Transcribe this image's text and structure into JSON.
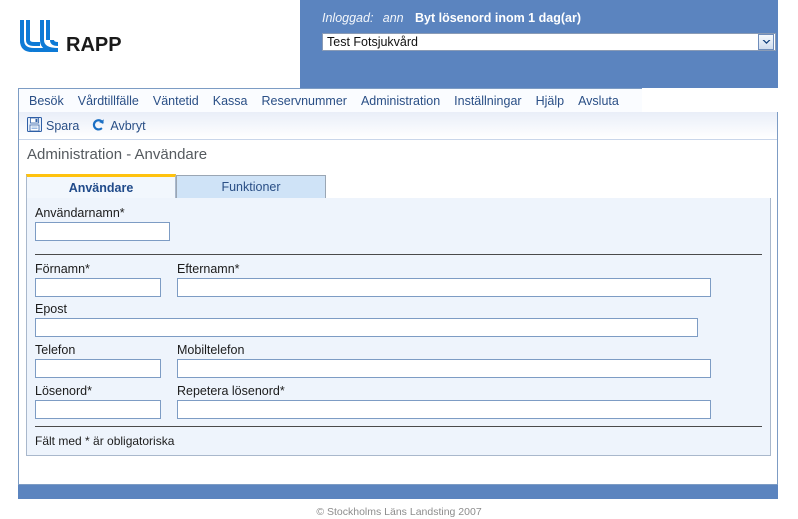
{
  "header": {
    "logo_text": "RAPP",
    "logo_icon": "jll-logo-icon",
    "login_label": "Inloggad:",
    "login_user": "ann",
    "password_warning": "Byt lösenord inom 1 dag(ar)",
    "unit_select_value": "Test Fotsjukvård",
    "unit_select_arrow_icon": "chevron-down-icon"
  },
  "menu": {
    "items": [
      {
        "label": "Besök"
      },
      {
        "label": "Vårdtillfälle"
      },
      {
        "label": "Väntetid"
      },
      {
        "label": "Kassa"
      },
      {
        "label": "Reservnummer"
      },
      {
        "label": "Administration"
      },
      {
        "label": "Inställningar"
      },
      {
        "label": "Hjälp"
      },
      {
        "label": "Avsluta"
      }
    ]
  },
  "toolbar": {
    "save_label": "Spara",
    "save_icon": "floppy-disk-icon",
    "cancel_label": "Avbryt",
    "cancel_icon": "undo-arrow-icon"
  },
  "page": {
    "title": "Administration - Användare"
  },
  "tabs": [
    {
      "label": "Användare",
      "active": true
    },
    {
      "label": "Funktioner",
      "active": false
    }
  ],
  "form": {
    "fields": [
      {
        "label": "Användarnamn*",
        "value": "",
        "placeholder": ""
      },
      {
        "label": "Förnamn*",
        "value": "",
        "placeholder": ""
      },
      {
        "label": "Efternamn*",
        "value": "",
        "placeholder": ""
      },
      {
        "label": "Epost",
        "value": "",
        "placeholder": ""
      },
      {
        "label": "Telefon",
        "value": "",
        "placeholder": ""
      },
      {
        "label": "Mobiltelefon",
        "value": "",
        "placeholder": ""
      },
      {
        "label": "Lösenord*",
        "value": "",
        "placeholder": ""
      },
      {
        "label": "Repetera lösenord*",
        "value": "",
        "placeholder": ""
      }
    ],
    "required_note": "Fält med * är obligatoriska"
  },
  "footer": {
    "copyright": "© Stockholms Läns Landsting 2007"
  },
  "colors": {
    "header_blue": "#5b84bf",
    "menu_link": "#2a4f86",
    "tab_active_accent": "#ffc20e",
    "tab_inactive_bg": "#cfe3f7",
    "form_bg": "#eef4fc",
    "input_border": "#7d9cc4",
    "logo_blue": "#0d7ad6"
  }
}
